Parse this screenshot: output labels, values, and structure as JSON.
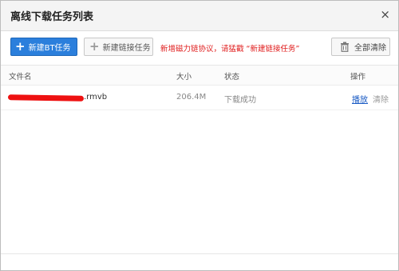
{
  "dialog": {
    "title": "离线下载任务列表",
    "close_label": "×"
  },
  "toolbar": {
    "new_bt_label": "新建BT任务",
    "new_link_label": "新建链接任务",
    "notice": "新增磁力链协议，请猛戳 “新建链接任务”",
    "clear_all_label": "全部清除"
  },
  "table": {
    "headers": {
      "name": "文件名",
      "size": "大小",
      "status": "状态",
      "actions": "操作"
    },
    "rows": [
      {
        "name": ".rmvb",
        "size": "206.4M",
        "status": "下载成功",
        "play": "播放",
        "clear": "清除"
      }
    ]
  },
  "colors": {
    "primary": "#2b7fdc",
    "notice": "#e02020",
    "link": "#1a5bc4"
  }
}
